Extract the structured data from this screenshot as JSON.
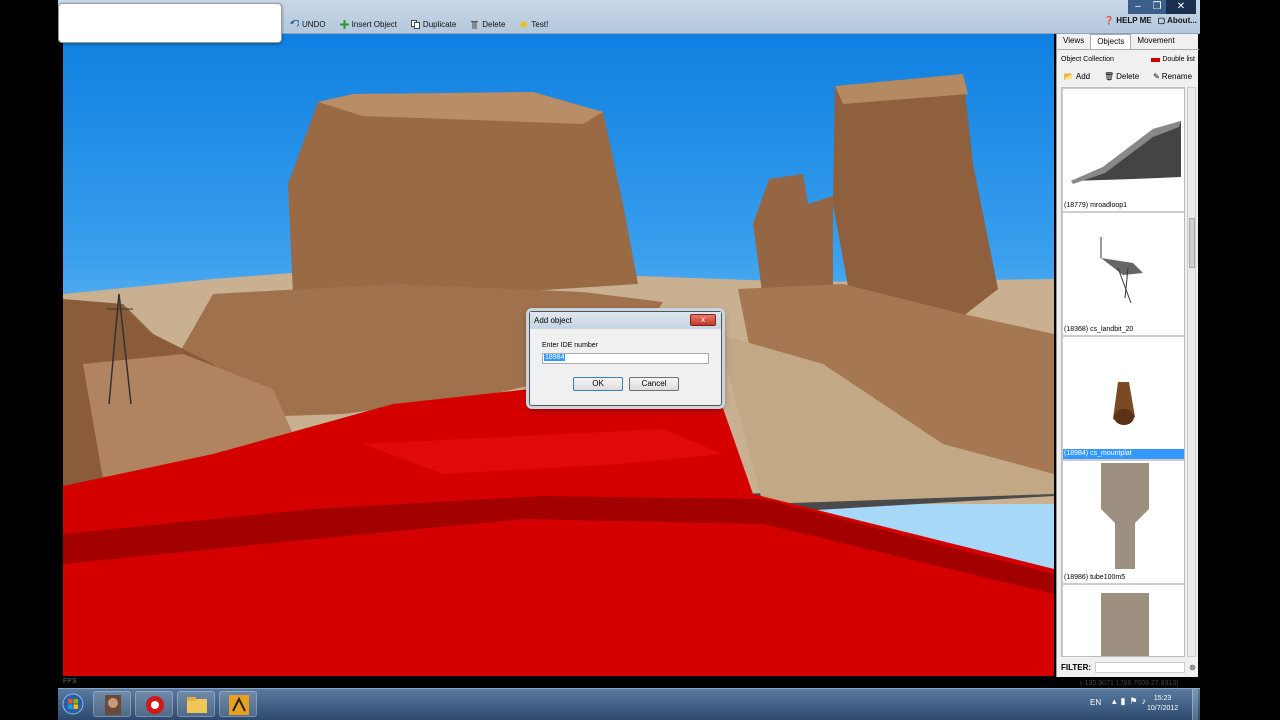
{
  "toolbar": {
    "undo_label": "UNDO",
    "insert_label": "Insert Object",
    "duplicate_label": "Duplicate",
    "delete_label": "Delete",
    "test_label": "Test!",
    "help_label": "HELP ME",
    "about_label": "About..."
  },
  "window_controls": {
    "minimize": "–",
    "maximize": "❐",
    "close": "✕"
  },
  "viewport": {
    "fps_label": "FPS"
  },
  "panel": {
    "tabs": [
      "Views",
      "Objects",
      "Movement"
    ],
    "active_tab": "Objects",
    "collection_label": "Object Collection",
    "double_list_label": "Double list",
    "add_label": "Add",
    "delete_label": "Delete",
    "rename_label": "Rename",
    "objects": [
      {
        "label": "(18779) mroadloop1"
      },
      {
        "label": "(18368) cs_landbit_20"
      },
      {
        "label": "(18984) cs_mountplat"
      },
      {
        "label": "(18986) tube100m5"
      },
      {
        "label": ""
      }
    ],
    "selected_index": 2,
    "filter_label": "FILTER:",
    "filter_value": "",
    "filter_clear": "⊗"
  },
  "status": {
    "coords": "(-135.9071 1786.7609 27.8313)"
  },
  "dialog": {
    "title": "Add object",
    "close_label": "x",
    "prompt": "Enter IDE number",
    "value": "18984",
    "ok_label": "OK",
    "cancel_label": "Cancel"
  },
  "taskbar": {
    "language": "EN",
    "time": "15:23",
    "date": "10/7/2012"
  }
}
